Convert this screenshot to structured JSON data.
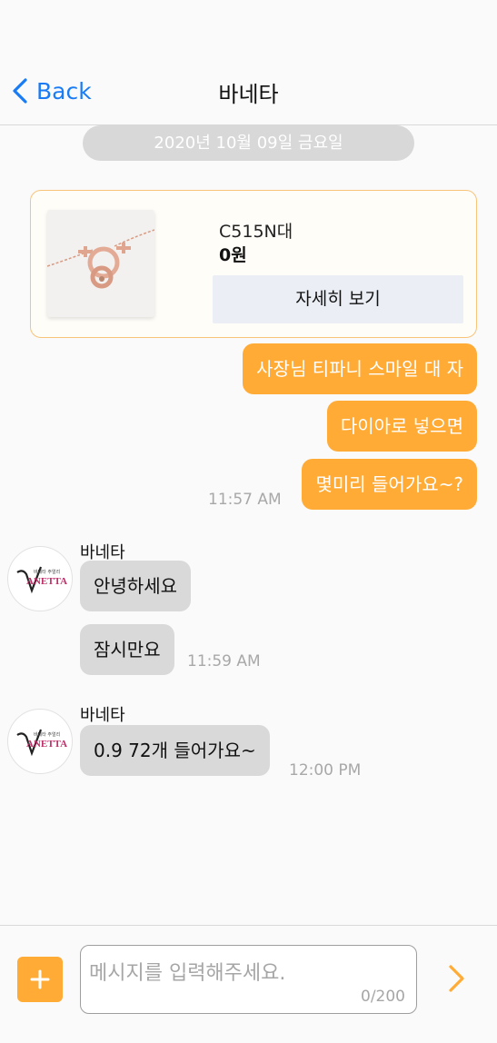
{
  "header": {
    "back_label": "Back",
    "title": "바네타"
  },
  "date_divider": "2020년 10월 09일 금요일",
  "product": {
    "code": "C515N대",
    "price": "0원",
    "detail_button": "자세히 보기"
  },
  "messages": {
    "sent": [
      "사장님 티파니 스마일 대 자",
      "다이아로 넣으면",
      "몇미리 들어가요~?"
    ],
    "sent_time": "11:57 AM",
    "group1": {
      "sender": "바네타",
      "messages": [
        "안녕하세요",
        "잠시만요"
      ],
      "time": "11:59 AM"
    },
    "group2": {
      "sender": "바네타",
      "messages": [
        "0.9  72개 들어가요~"
      ],
      "time": "12:00 PM"
    }
  },
  "avatar_logo": {
    "small": "바네타 주얼리",
    "big": "ANETTA"
  },
  "input": {
    "placeholder": "메시지를 입력해주세요.",
    "count": "0/200"
  },
  "colors": {
    "accent": "#ffab36",
    "link": "#1a7cf5",
    "received": "#d9d9d9",
    "logo": "#c0306a"
  }
}
